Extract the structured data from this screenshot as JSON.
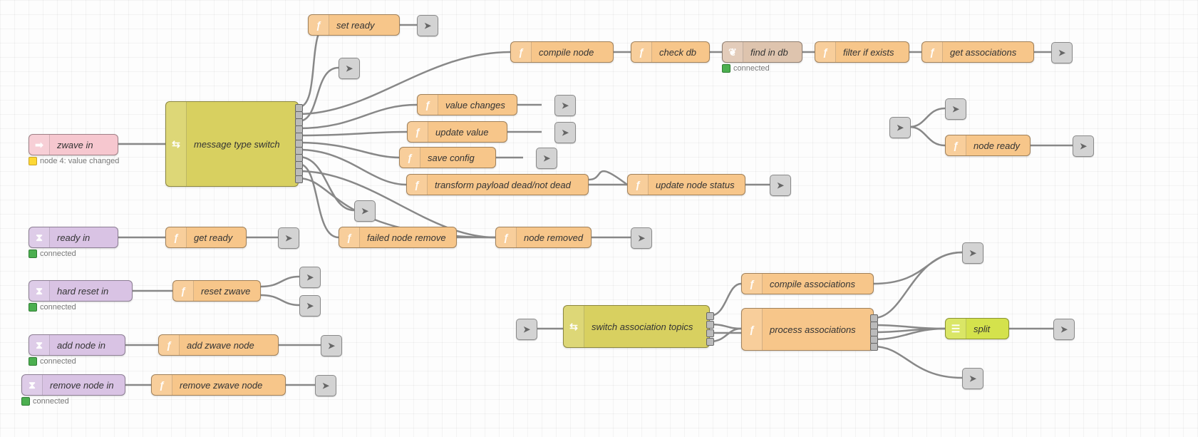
{
  "nodes": {
    "zwave_in": {
      "label": "zwave in"
    },
    "msg_switch": {
      "label": "message type switch"
    },
    "set_ready": {
      "label": "set ready"
    },
    "compile_node": {
      "label": "compile node"
    },
    "check_db": {
      "label": "check db"
    },
    "find_in_db": {
      "label": "find in db"
    },
    "filter_if_exists": {
      "label": "filter if exists"
    },
    "get_assoc": {
      "label": "get associations"
    },
    "value_changes": {
      "label": "value changes"
    },
    "update_value": {
      "label": "update value"
    },
    "save_config": {
      "label": "save config"
    },
    "transform_dead": {
      "label": "transform payload dead/not dead"
    },
    "update_status": {
      "label": "update node status"
    },
    "failed_remove": {
      "label": "failed node remove"
    },
    "node_removed": {
      "label": "node removed"
    },
    "ready_in": {
      "label": "ready in"
    },
    "get_ready": {
      "label": "get ready"
    },
    "hard_reset_in": {
      "label": "hard reset in"
    },
    "reset_zwave": {
      "label": "reset zwave"
    },
    "add_node_in": {
      "label": "add node in"
    },
    "add_zwave_node": {
      "label": "add zwave node"
    },
    "remove_node_in": {
      "label": "remove node in"
    },
    "remove_zwave": {
      "label": "remove zwave node"
    },
    "node_ready": {
      "label": "node ready"
    },
    "switch_assoc": {
      "label": "switch association topics"
    },
    "compile_assoc": {
      "label": "compile associations"
    },
    "process_assoc": {
      "label": "process associations"
    },
    "split": {
      "label": "split"
    }
  },
  "status": {
    "zwave_in": "node 4: value changed",
    "find_in_db": "connected",
    "ready_in": "connected",
    "hard_reset_in": "connected",
    "add_node_in": "connected",
    "remove_node_in": "connected"
  }
}
